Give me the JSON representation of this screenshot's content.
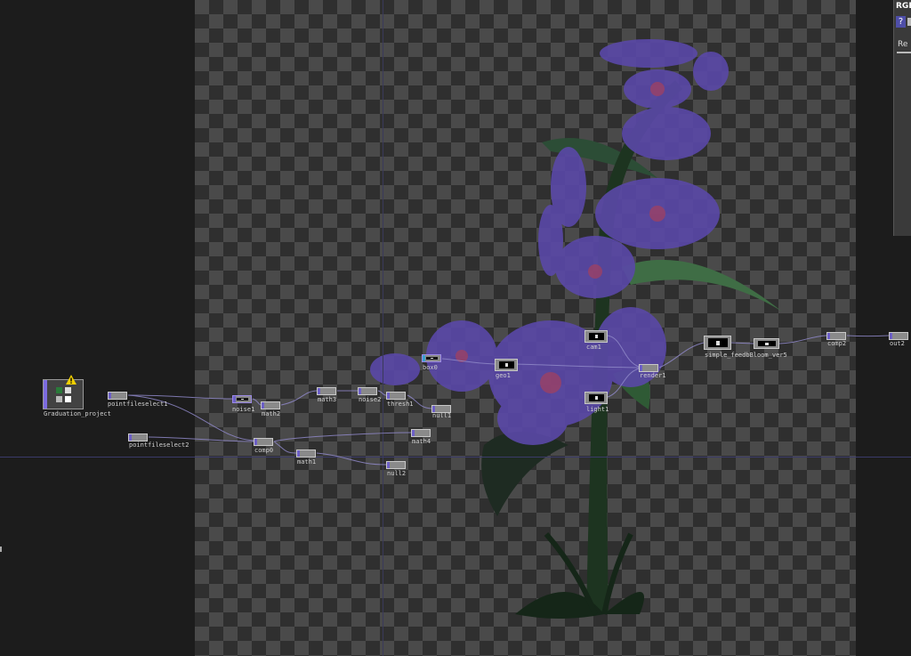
{
  "param_panel": {
    "title": "RGB",
    "help": "?",
    "tab_label": "Re"
  },
  "network": {
    "component": {
      "label": "Graduation_project",
      "icon": "warning-icon"
    },
    "nodes": [
      {
        "id": "pointfileselect1",
        "label": "pointfileselect1"
      },
      {
        "id": "pointfileselect2",
        "label": "pointfileselect2"
      },
      {
        "id": "noise1",
        "label": "noise1"
      },
      {
        "id": "math2",
        "label": "math2"
      },
      {
        "id": "comp0",
        "label": "comp0"
      },
      {
        "id": "math1",
        "label": "math1"
      },
      {
        "id": "math3",
        "label": "math3"
      },
      {
        "id": "noise2",
        "label": "noise2"
      },
      {
        "id": "thresh1",
        "label": "thresh1"
      },
      {
        "id": "null1",
        "label": "null1"
      },
      {
        "id": "math4",
        "label": "math4"
      },
      {
        "id": "null2",
        "label": "null2"
      },
      {
        "id": "box0",
        "label": "box0"
      },
      {
        "id": "geo1",
        "label": "geo1"
      },
      {
        "id": "cam1",
        "label": "cam1"
      },
      {
        "id": "light1",
        "label": "light1"
      },
      {
        "id": "render1",
        "label": "render1"
      },
      {
        "id": "simple_feed",
        "label": "simple_feedbBloom_ver5"
      },
      {
        "id": "comp2",
        "label": "comp2"
      },
      {
        "id": "out2",
        "label": "out2"
      }
    ]
  },
  "colors": {
    "accent": "#6c5fc6",
    "wire": "#8f88c8",
    "flower": "#5a48a8",
    "stem": "#1f3a22"
  }
}
